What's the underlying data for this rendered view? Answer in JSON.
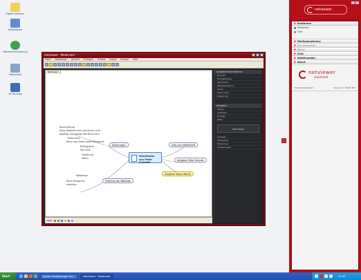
{
  "desktop": {
    "icons": [
      {
        "label": "Eigene Dateien",
        "color": "#f2d15a"
      },
      {
        "label": "Arbeitsplatz",
        "color": "#5f8ed0"
      },
      {
        "label": "Netzwerkumgebung",
        "color": "#3ca24a"
      },
      {
        "label": "Papierkorb",
        "color": "#8aa3c8"
      },
      {
        "label": "To Do-Liste",
        "color": "#3d6db8"
      }
    ]
  },
  "window": {
    "title": "netviewer · Moderator",
    "menu": [
      "Datei",
      "Bearbeiten",
      "Ansicht",
      "Einfügen",
      "Format",
      "Extras",
      "Fenster",
      "Hilfe"
    ],
    "doc_tab": "Netviewer",
    "mindmap": {
      "central": "Webinhalte von Peter Schmidt",
      "branches": {
        "aenderungen": "Änderungen",
        "infos": "Infos zum Webauftritt",
        "aufgaben": "Aufgaben Peter Schmidt",
        "probleme": "Probleme der Webseite",
        "aufgaben_gelb": "Aufgaben dieser Woche"
      },
      "notes": {
        "n1": "Beschreibung",
        "n2": "Diese Webseite wird seit Jahren nicht",
        "n3": "gepflegt, das Design fällt Besuchern",
        "n4": "Materialien",
        "n5": "Neue Logo Datei sowie Bildgalerie",
        "n6": "Bildergalerie",
        "n7": "Mai 2008",
        "n8": "Inhalte aus",
        "n9": "Daten",
        "n10": "Webdesign",
        "n11": "Neue Kategorien",
        "n12": "erweitern"
      }
    },
    "side_pane": {
      "title1": "Aufgabeninformationen",
      "rows1": [
        "Priorität",
        "Fertigstellung",
        "Startdatum",
        "Fälligkeitsdatum",
        "Dauer",
        "Ressourcen",
        "Kategorien"
      ],
      "title2": "Aufgaben",
      "rows2": [
        "Status",
        "Aufgaben",
        "Erledigt",
        "Offen"
      ],
      "logo_text": "netviewer",
      "rows3": [
        "Anzeige",
        "Teilnehmer",
        "Steuerung",
        "Einstellungen"
      ]
    }
  },
  "panel": {
    "logo": "netviewer",
    "sections": {
      "konferenz": "Konferenz",
      "telefonkonferenz": "Telefonkonferenz",
      "teilnehmer": "Teilnehmerliste",
      "status": "Status",
      "chat": "Chat",
      "dateitransfer": "Dateitransfer",
      "about": "About"
    },
    "participants": [
      {
        "name": "Moderator",
        "color": "#2d5fc2"
      },
      {
        "name": "Gast",
        "color": "#4a9a3c"
      }
    ],
    "about": {
      "brand": "netviewer",
      "product": "one2meet",
      "left": "Teilnehmersystem",
      "right": "Version 3.1 Build 387"
    }
  },
  "taskbar": {
    "start": "Start",
    "tasks": [
      "Nutzer MindManager Pro...",
      "Netviewer · Moderator"
    ],
    "clock": "10:45"
  }
}
